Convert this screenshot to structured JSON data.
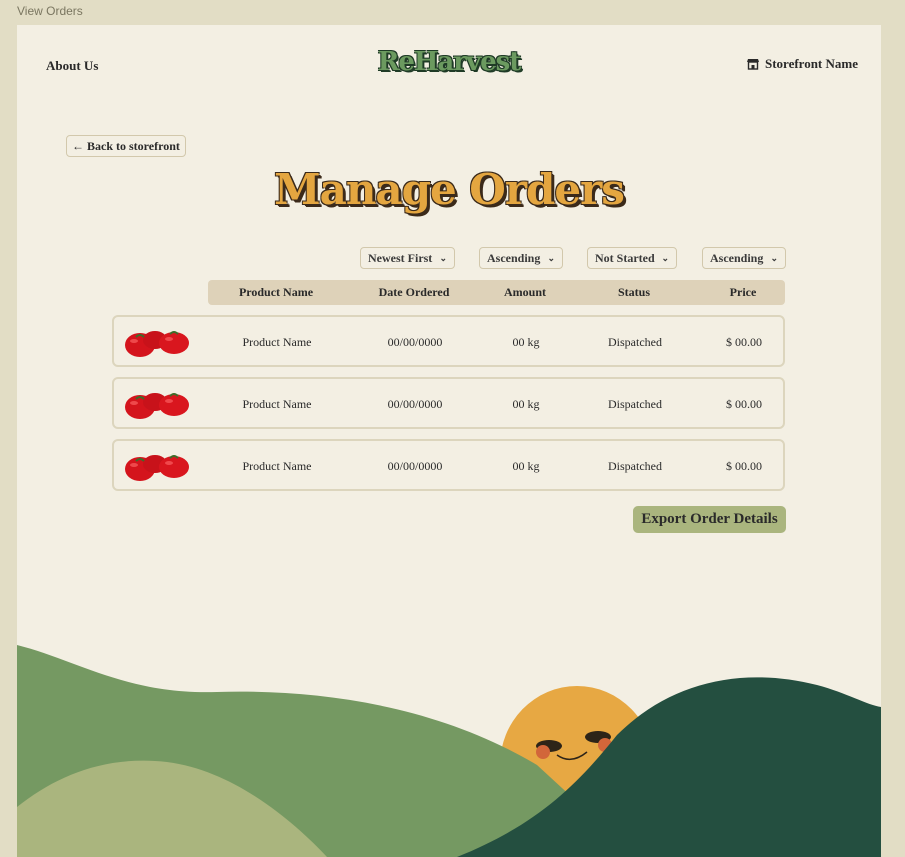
{
  "frame_label": "View Orders",
  "nav": {
    "about": "About Us",
    "logo": "ReHarvest",
    "storefront": "Storefront Name"
  },
  "back_button": "← Back to storefront",
  "title": "Manage Orders",
  "filters": [
    "Newest First",
    "Ascending",
    "Not Started",
    "Ascending"
  ],
  "columns": [
    "Product Name",
    "Date Ordered",
    "Amount",
    "Status",
    "Price"
  ],
  "orders": [
    {
      "product": "Product Name",
      "date": "00/00/0000",
      "amount": "00 kg",
      "status": "Dispatched",
      "price": "$ 00.00"
    },
    {
      "product": "Product Name",
      "date": "00/00/0000",
      "amount": "00 kg",
      "status": "Dispatched",
      "price": "$ 00.00"
    },
    {
      "product": "Product Name",
      "date": "00/00/0000",
      "amount": "00 kg",
      "status": "Dispatched",
      "price": "$ 00.00"
    }
  ],
  "export_button": "Export Order Details",
  "colors": {
    "background": "#f3efe3",
    "title_accent": "#e4a640",
    "logo_green": "#6b9a5f",
    "header_bar": "#ded2b9",
    "export_button": "#aab57e",
    "hill_light": "#aab57e",
    "hill_mid": "#759962",
    "hill_dark": "#244f40",
    "sun": "#e7a843"
  },
  "icons": [
    "storefront-icon",
    "tomato-icon",
    "chevron-down-icon",
    "smiling-sun-icon"
  ]
}
